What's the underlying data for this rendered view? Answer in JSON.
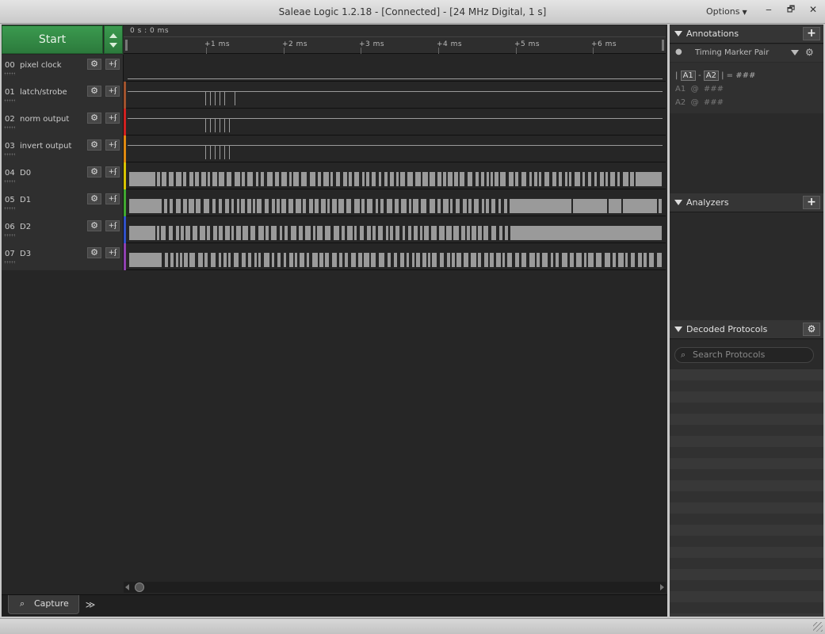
{
  "window": {
    "title": "Saleae Logic 1.2.18 - [Connected] - [24 MHz Digital, 1 s]",
    "options_label": "Options",
    "minimize": "‒",
    "maximize": "🗗",
    "close": "✕"
  },
  "capture": {
    "start_label": "Start"
  },
  "timeline": {
    "origin": "0 s : 0 ms",
    "ticks": [
      "+1 ms",
      "+2 ms",
      "+3 ms",
      "+4 ms",
      "+5 ms",
      "+6 ms"
    ]
  },
  "channels": [
    {
      "num": "00",
      "name": "pixel clock",
      "color": "#262626"
    },
    {
      "num": "01",
      "name": "latch/strobe",
      "color": "#a0522d"
    },
    {
      "num": "02",
      "name": "norm output",
      "color": "#d02020"
    },
    {
      "num": "03",
      "name": "invert output",
      "color": "#e08a10"
    },
    {
      "num": "04",
      "name": "D0",
      "color": "#d8c400"
    },
    {
      "num": "05",
      "name": "D1",
      "color": "#40a830"
    },
    {
      "num": "06",
      "name": "D2",
      "color": "#3050c8"
    },
    {
      "num": "07",
      "name": "D3",
      "color": "#9040b0"
    }
  ],
  "channel_button_labels": {
    "settings": "⚙",
    "trigger": "+ʄ"
  },
  "tabs": {
    "capture": "Capture",
    "overflow": "≫"
  },
  "annotations": {
    "title": "Annotations",
    "add": "+",
    "marker_name": "Timing Marker Pair",
    "formula": {
      "a1": "A1",
      "a2": "A2",
      "value": "###"
    },
    "a1_line": {
      "label": "A1",
      "at": "@",
      "value": "###"
    },
    "a2_line": {
      "label": "A2",
      "at": "@",
      "value": "###"
    }
  },
  "analyzers": {
    "title": "Analyzers",
    "add": "+"
  },
  "decoded_protocols": {
    "title": "Decoded Protocols",
    "settings": "⚙",
    "search_placeholder": "Search Protocols"
  }
}
